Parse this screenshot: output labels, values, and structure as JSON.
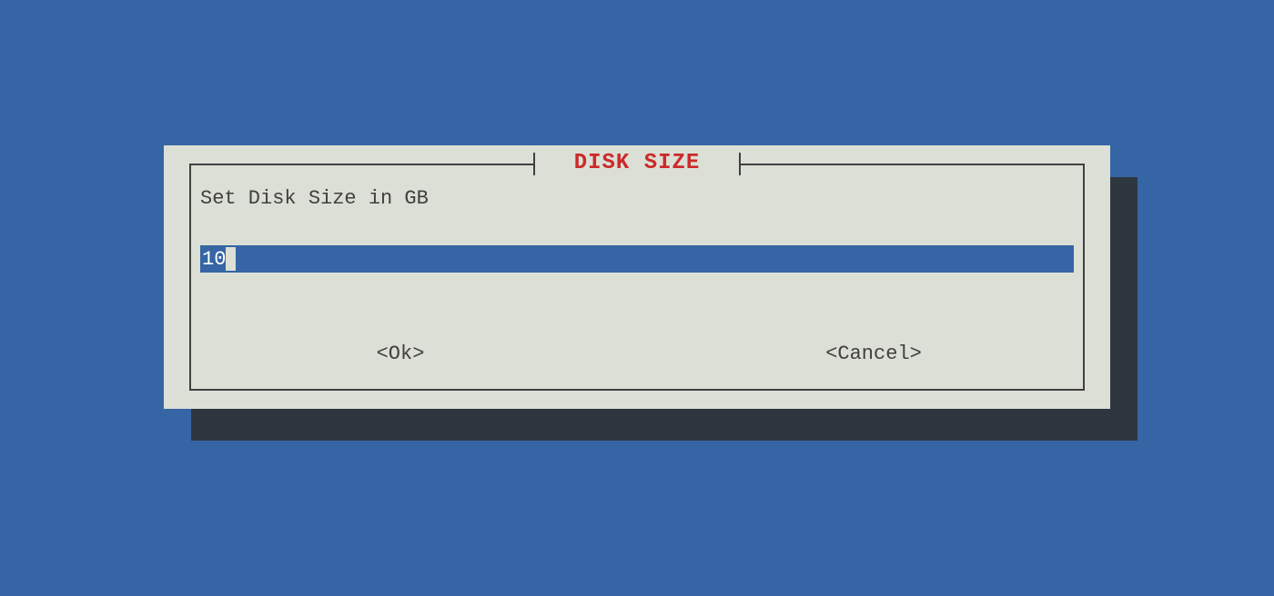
{
  "dialog": {
    "title": "DISK SIZE",
    "prompt": "Set Disk Size in GB",
    "input_value": "10",
    "buttons": {
      "ok_label": "<Ok>",
      "cancel_label": "<Cancel>"
    }
  },
  "colors": {
    "background": "#3565a4",
    "dialog_bg": "#dcdfd5",
    "shadow": "#2e3740",
    "title": "#cb2a2a",
    "text": "#404040",
    "input_bg": "#3565a4",
    "input_fg": "#ffffff"
  }
}
